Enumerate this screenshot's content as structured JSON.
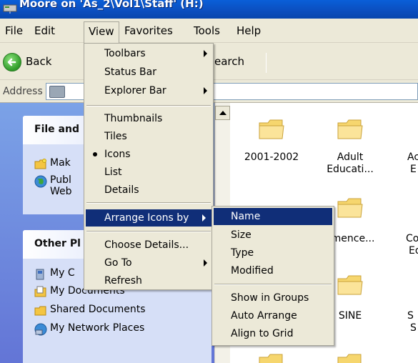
{
  "window": {
    "title": "Moore on 'As_2\\Vol1\\Staff' (H:)"
  },
  "menubar": {
    "items": [
      {
        "label": "File"
      },
      {
        "label": "Edit"
      },
      {
        "label": "View"
      },
      {
        "label": "Favorites"
      },
      {
        "label": "Tools"
      },
      {
        "label": "Help"
      }
    ]
  },
  "toolbar": {
    "back_label": "Back",
    "search_label": "earch"
  },
  "address": {
    "label": "Address"
  },
  "taskpane": {
    "file_tasks": {
      "title": "File and",
      "items": [
        {
          "label": "Mak"
        },
        {
          "label": "Publ"
        },
        {
          "label": "Web"
        }
      ]
    },
    "other_places": {
      "title": "Other Pl",
      "items": [
        {
          "label": "My C"
        },
        {
          "label": "My Documents"
        },
        {
          "label": "Shared Documents"
        },
        {
          "label": "My Network Places"
        }
      ]
    }
  },
  "files": {
    "row1": [
      "2001-2002",
      "Adult Educati...",
      "Ac",
      "E"
    ],
    "row2": [
      "mmence...",
      "Cor",
      "Ed"
    ],
    "row3": [
      "SINE",
      "S",
      "S"
    ]
  },
  "view_menu": {
    "items": [
      {
        "label": "Toolbars",
        "submenu": true
      },
      {
        "label": "Status Bar"
      },
      {
        "label": "Explorer Bar",
        "submenu": true
      },
      {
        "label": "Thumbnails"
      },
      {
        "label": "Tiles"
      },
      {
        "label": "Icons",
        "checked": true
      },
      {
        "label": "List"
      },
      {
        "label": "Details"
      },
      {
        "label": "Arrange Icons by",
        "submenu": true,
        "highlighted": true
      },
      {
        "label": "Choose Details..."
      },
      {
        "label": "Go To",
        "submenu": true
      },
      {
        "label": "Refresh"
      }
    ]
  },
  "arrange_menu": {
    "items": [
      {
        "label": "Name",
        "highlighted": true
      },
      {
        "label": "Size"
      },
      {
        "label": "Type"
      },
      {
        "label": "Modified"
      },
      {
        "label": "Show in Groups"
      },
      {
        "label": "Auto Arrange"
      },
      {
        "label": "Align to Grid"
      }
    ]
  },
  "colors": {
    "menu_highlight": "#102e78",
    "menu_bg": "#ece9d8",
    "taskpane_bg": "#7ba2e7",
    "title_bar": "#0b4fc0"
  }
}
